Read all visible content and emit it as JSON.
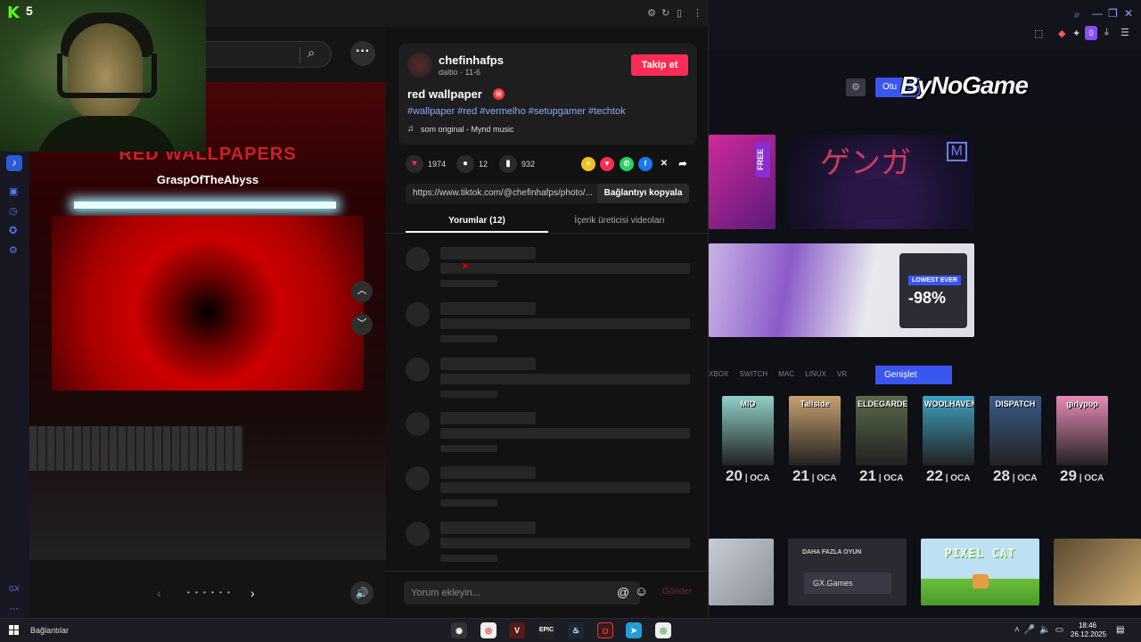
{
  "webcam": {
    "kick_logo": "K",
    "viewer_count": "5"
  },
  "tiktok": {
    "author": {
      "name": "chefinhafps",
      "sub": "daltio · 11-6",
      "follow_label": "Takip et"
    },
    "post": {
      "title": "red wallpaper",
      "title_emoji": "㊙",
      "hashtags": "#wallpaper #red #vermelho #setupgamer #techtok",
      "music": "som original - Mynd music"
    },
    "photo": {
      "title": "RED WALLPAPERS",
      "author": "GraspOfTheAbyss"
    },
    "stats": {
      "likes": "1974",
      "comments": "12",
      "saves": "932"
    },
    "share_icons": [
      "coin-icon",
      "tiktok-share-icon",
      "whatsapp-icon",
      "facebook-icon",
      "x-icon",
      "share-arrow-icon"
    ],
    "link": {
      "url": "https://www.tiktok.com/@chefinhafps/photo/...",
      "copy_label": "Bağlantıyı kopyala"
    },
    "tabs": {
      "comments": "Yorumlar (12)",
      "creator_videos": "İçerik üreticisi videoları"
    },
    "comment_input": {
      "placeholder": "Yorum ekleyin...",
      "send_label": "Gönder"
    },
    "pager_dots": "• • • • • •"
  },
  "store": {
    "logo": "ByNoGame",
    "free_badge": "FREE",
    "gengar_text": "ゲンガ",
    "lowest_label": "LOWEST EVER",
    "lowest_pct": "-98%",
    "platforms": "XBOX SWITCH MAC LINUX VR",
    "expand_label": "Genişlet",
    "more_games_label": "DAHA FAZLA OYUN",
    "gx_games_label": "GX.Games",
    "pixel_cat_title": "PIXEL CAT",
    "releases": [
      {
        "title": "MIO",
        "day": "20",
        "month": "OCA",
        "color": "#8fd0c8"
      },
      {
        "title": "Tailside",
        "day": "21",
        "month": "OCA",
        "color": "#c9a070"
      },
      {
        "title": "ELDEGARDE",
        "day": "21",
        "month": "OCA",
        "color": "#5a6a4a"
      },
      {
        "title": "WOOLHAVEN",
        "day": "22",
        "month": "OCA",
        "color": "#3fa0c0"
      },
      {
        "title": "DISPATCH",
        "day": "28",
        "month": "OCA",
        "color": "#3b5b8a"
      },
      {
        "title": "girlypop",
        "day": "29",
        "month": "OCA",
        "color": "#e88ab8"
      }
    ]
  },
  "taskbar": {
    "label": "Bağlantılar",
    "time": "18:46",
    "date": "26.12.2025"
  }
}
